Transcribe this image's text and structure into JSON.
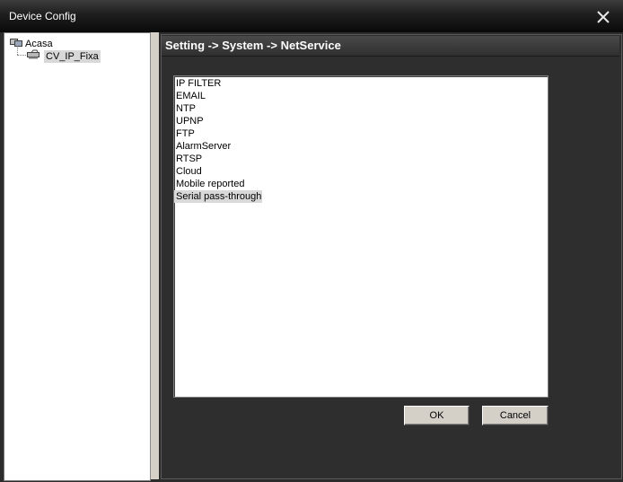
{
  "window": {
    "title": "Device Config"
  },
  "tree": {
    "root_label": "Acasa",
    "child_label": "CV_IP_Fixa"
  },
  "panel": {
    "header": "Setting -> System -> NetService"
  },
  "services": [
    {
      "label": "IP FILTER",
      "selected": false
    },
    {
      "label": "EMAIL",
      "selected": false
    },
    {
      "label": "NTP",
      "selected": false
    },
    {
      "label": "UPNP",
      "selected": false
    },
    {
      "label": "FTP",
      "selected": false
    },
    {
      "label": "AlarmServer",
      "selected": false
    },
    {
      "label": "RTSP",
      "selected": false
    },
    {
      "label": "Cloud",
      "selected": false
    },
    {
      "label": "Mobile reported",
      "selected": false
    },
    {
      "label": "Serial pass-through",
      "selected": true
    }
  ],
  "buttons": {
    "ok": "OK",
    "cancel": "Cancel"
  },
  "colors": {
    "selection": "#d9d9d9",
    "panel_bg": "#2e2e2e",
    "title_text": "#ffffff"
  }
}
